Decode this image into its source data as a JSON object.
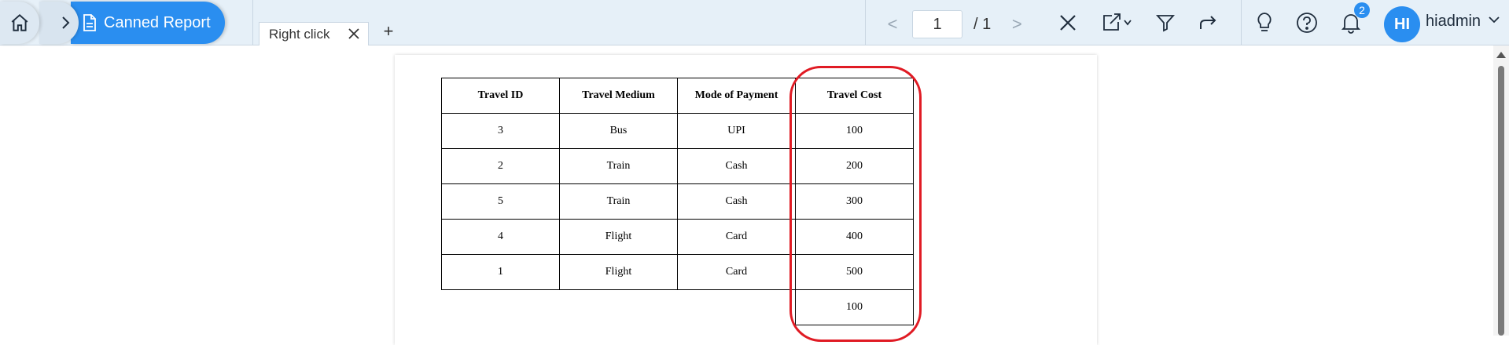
{
  "header": {
    "breadcrumb_active": "Canned Report",
    "tab_label": "Right click",
    "add_tab": "+",
    "pager": {
      "prev": "<",
      "current_page": "1",
      "total": "/ 1",
      "next": ">"
    },
    "notifications_count": "2",
    "avatar_initials": "HI",
    "username": "hiadmin"
  },
  "report": {
    "headers": [
      "Travel ID",
      "Travel Medium",
      "Mode of Payment",
      "Travel Cost"
    ],
    "rows": [
      [
        "3",
        "Bus",
        "UPI",
        "100"
      ],
      [
        "2",
        "Train",
        "Cash",
        "200"
      ],
      [
        "5",
        "Train",
        "Cash",
        "300"
      ],
      [
        "4",
        "Flight",
        "Card",
        "400"
      ],
      [
        "1",
        "Flight",
        "Card",
        "500"
      ]
    ],
    "total_row": [
      "",
      "",
      "",
      "100"
    ]
  },
  "colors": {
    "accent": "#2a8ef0",
    "highlight": "#e01b24",
    "topbar": "#e6f0f8"
  }
}
